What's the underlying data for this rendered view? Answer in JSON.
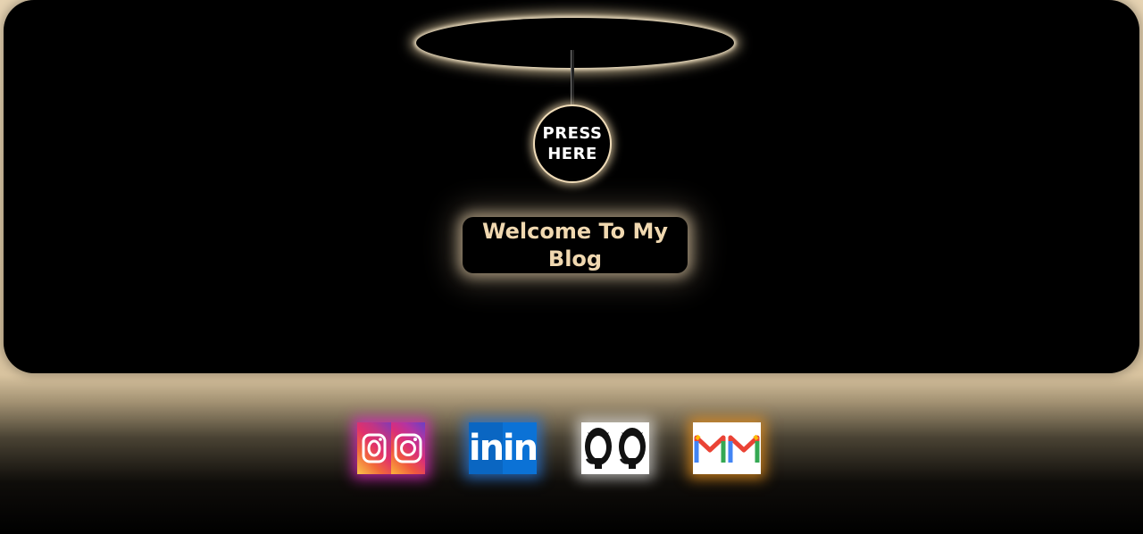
{
  "lamp": {
    "button_line1": "PRESS",
    "button_line2": "HERE"
  },
  "hero": {
    "title_line1": "Welcome To My",
    "title_line2": "Blog"
  },
  "socials": [
    {
      "name": "instagram",
      "icon": "instagram-icon",
      "color": "#e1306c"
    },
    {
      "name": "linkedin",
      "icon": "linkedin-icon",
      "color": "#0a66c2",
      "glyph": "in"
    },
    {
      "name": "github",
      "icon": "github-icon",
      "color": "#ffffff"
    },
    {
      "name": "gmail",
      "icon": "gmail-icon",
      "color": "#ea4335"
    }
  ],
  "colors": {
    "accent": "#f0d8b0",
    "background": "#e6d3b2",
    "stage": "#000000"
  }
}
